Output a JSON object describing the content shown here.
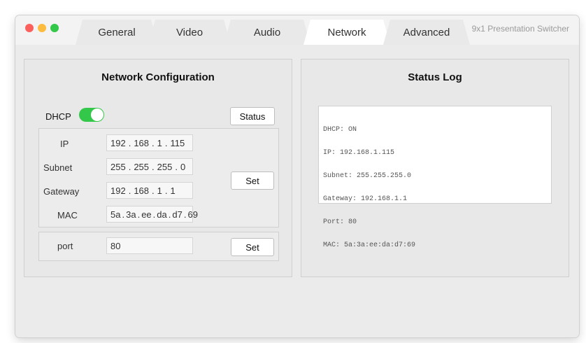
{
  "window": {
    "title": "9x1 Presentation Switcher",
    "tabs": [
      {
        "label": "General",
        "active": false
      },
      {
        "label": "Video",
        "active": false
      },
      {
        "label": "Audio",
        "active": false
      },
      {
        "label": "Network",
        "active": true
      },
      {
        "label": "Advanced",
        "active": false
      }
    ]
  },
  "network_config": {
    "title": "Network Configuration",
    "dhcp_label": "DHCP",
    "dhcp_enabled": true,
    "status_button": "Status",
    "labels": {
      "ip": "IP",
      "subnet": "Subnet",
      "gateway": "Gateway",
      "mac": "MAC"
    },
    "ip": [
      "192",
      "168",
      "1",
      "115"
    ],
    "subnet": [
      "255",
      "255",
      "255",
      "0"
    ],
    "gateway": [
      "192",
      "168",
      "1",
      "1"
    ],
    "mac": [
      "5a",
      "3a",
      "ee",
      "da",
      "d7",
      "69"
    ],
    "set_button": "Set",
    "port_label": "port",
    "port_value": "80",
    "port_set_button": "Set"
  },
  "status_log": {
    "title": "Status Log",
    "lines": [
      "DHCP: ON",
      "IP: 192.168.1.115",
      "Subnet: 255.255.255.0",
      "Gateway: 192.168.1.1",
      "Port: 80",
      "MAC: 5a:3a:ee:da:d7:69"
    ]
  },
  "colors": {
    "toggle_on": "#34c84a",
    "close": "#fc605c",
    "minimize": "#fdbc40",
    "maximize": "#34c84a"
  }
}
